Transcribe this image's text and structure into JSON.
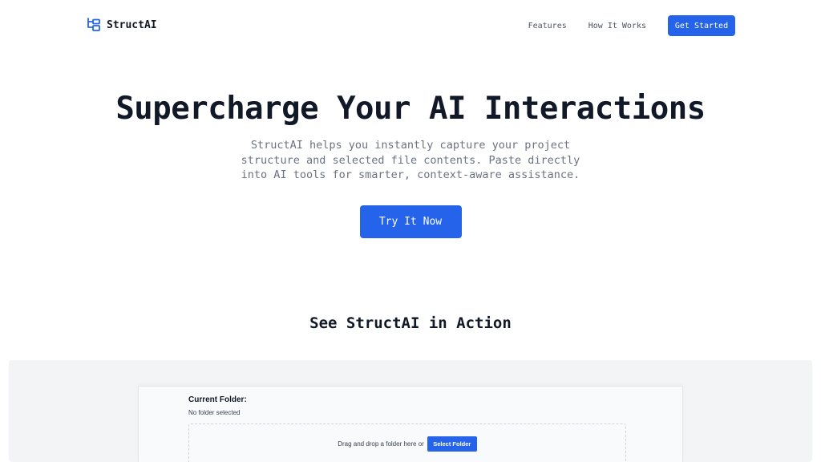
{
  "nav": {
    "brand": "StructAI",
    "links": [
      "Features",
      "How It Works"
    ],
    "cta": "Get Started"
  },
  "hero": {
    "title": "Supercharge Your AI Interactions",
    "subtitle": "StructAI helps you instantly capture your project structure and selected file contents. Paste directly into AI tools for smarter, context-aware assistance.",
    "cta": "Try It Now"
  },
  "demo": {
    "heading": "See StructAI in Action",
    "current_folder_label": "Current Folder:",
    "current_folder_value": "No folder selected",
    "dropzone_text": "Drag and drop a folder here or",
    "select_button": "Select Folder"
  },
  "colors": {
    "accent": "#2563eb",
    "text": "#111827",
    "muted": "#6b7280"
  },
  "icons": {
    "brand": "folder-tree-icon"
  }
}
